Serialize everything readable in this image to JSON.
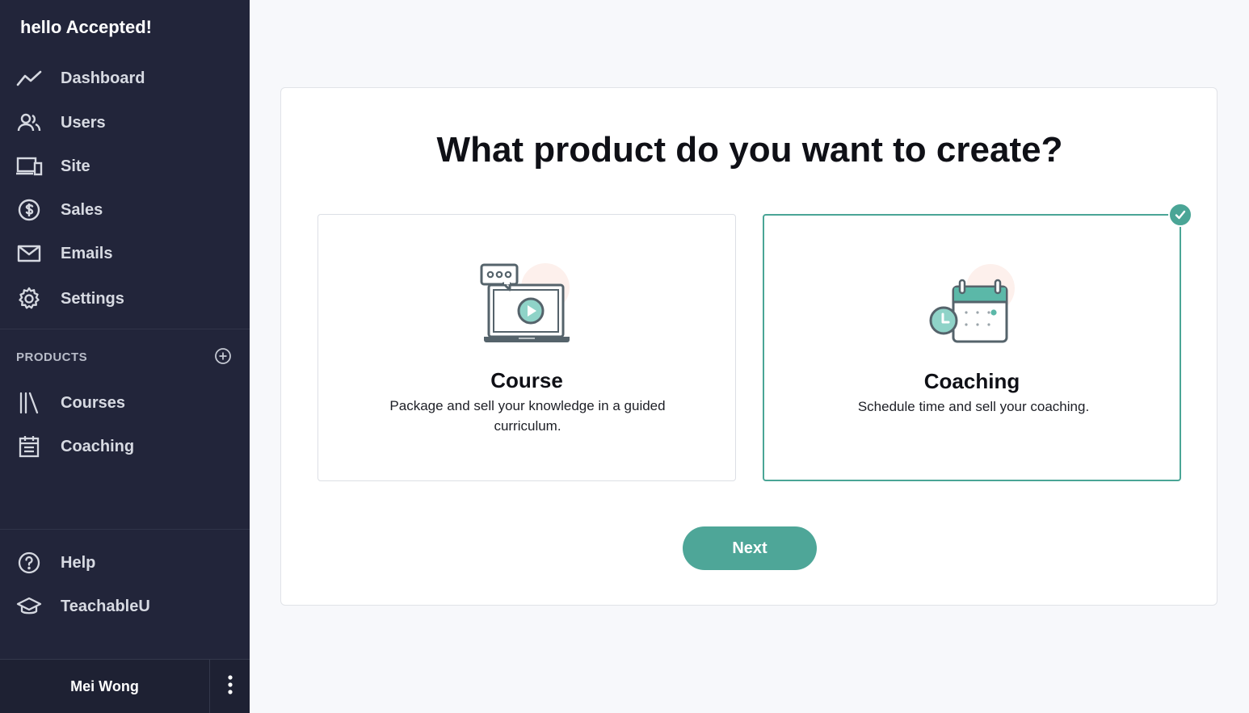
{
  "sidebar": {
    "greeting": "hello Accepted!",
    "main_nav": [
      {
        "label": "Dashboard",
        "icon": "chart-line-icon"
      },
      {
        "label": "Users",
        "icon": "users-icon"
      },
      {
        "label": "Site",
        "icon": "devices-icon"
      },
      {
        "label": "Sales",
        "icon": "dollar-circle-icon"
      },
      {
        "label": "Emails",
        "icon": "envelope-icon"
      },
      {
        "label": "Settings",
        "icon": "gear-icon"
      }
    ],
    "products_section": {
      "title": "PRODUCTS",
      "add_icon": "plus-circle-icon",
      "items": [
        {
          "label": "Courses",
          "icon": "library-icon"
        },
        {
          "label": "Coaching",
          "icon": "calendar-list-icon"
        }
      ]
    },
    "bottom_nav": [
      {
        "label": "Help",
        "icon": "question-circle-icon"
      },
      {
        "label": "TeachableU",
        "icon": "graduation-cap-icon"
      }
    ],
    "user": {
      "name": "Mei Wong",
      "menu_icon": "kebab-menu-icon"
    }
  },
  "main": {
    "title": "What product do you want to create?",
    "options": [
      {
        "title": "Course",
        "description": "Package and sell your knowledge in a guided curriculum.",
        "icon": "laptop-video-icon",
        "selected": false
      },
      {
        "title": "Coaching",
        "description": "Schedule time and sell your coaching.",
        "icon": "calendar-clock-icon",
        "selected": true
      }
    ],
    "next_label": "Next"
  },
  "colors": {
    "sidebar_bg": "#22253a",
    "accent": "#4ea698",
    "page_bg": "#f7f8fb"
  }
}
